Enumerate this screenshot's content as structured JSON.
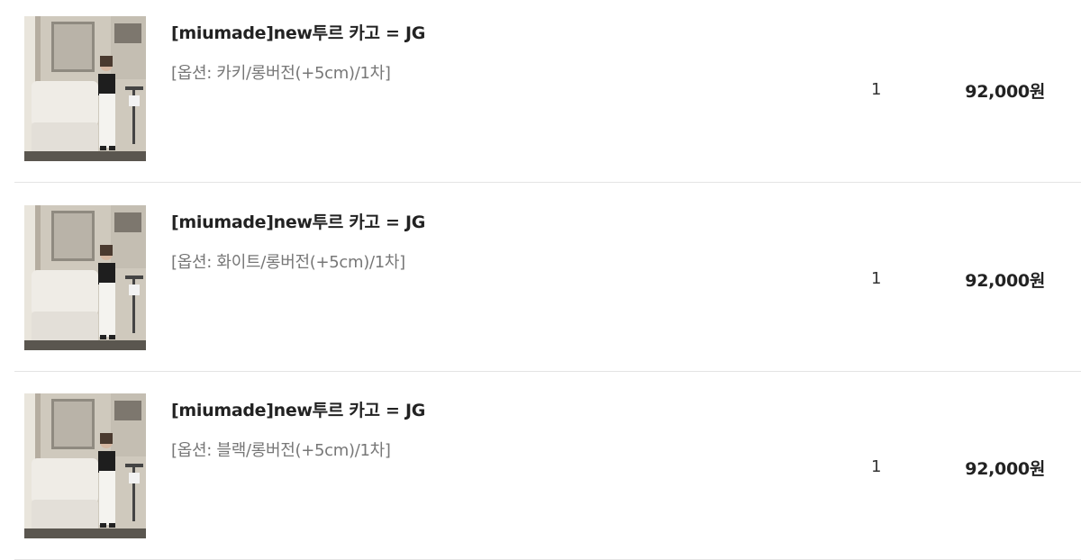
{
  "order_items": [
    {
      "name": "[miumade]new투르 카고 = JG",
      "option": "[옵션: 카키/롱버전(+5cm)/1차]",
      "quantity": "1",
      "price": "92,000원",
      "image_alt": "miumade new투르 카고 product photo"
    },
    {
      "name": "[miumade]new투르 카고 = JG",
      "option": "[옵션: 화이트/롱버전(+5cm)/1차]",
      "quantity": "1",
      "price": "92,000원",
      "image_alt": "miumade new투르 카고 product photo"
    },
    {
      "name": "[miumade]new투르 카고 = JG",
      "option": "[옵션: 블랙/롱버전(+5cm)/1차]",
      "quantity": "1",
      "price": "92,000원",
      "image_alt": "miumade new투르 카고 product photo"
    }
  ],
  "colors": {
    "name_text": "#222222",
    "option_text": "#777777",
    "divider": "#e4e4e4"
  }
}
